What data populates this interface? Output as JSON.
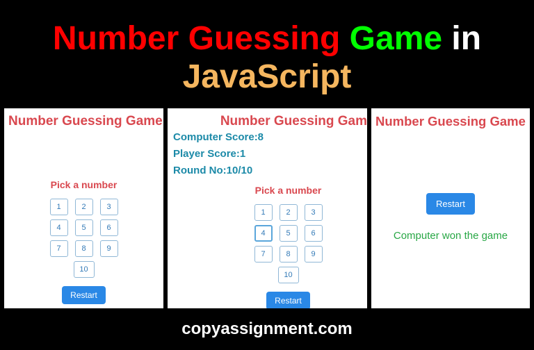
{
  "headline": {
    "parts": [
      {
        "text": "Number Guessing",
        "color": "#ff0000"
      },
      {
        "text": " ",
        "color": "#ffffff"
      },
      {
        "text": "Game",
        "color": "#00ff00"
      },
      {
        "text": " in",
        "color": "#ffffff"
      },
      {
        "text": " JavaScript",
        "color": "#f5b65f"
      }
    ]
  },
  "shots": {
    "title": "Number Guessing Game",
    "title_cut": "Number Guessing Gam",
    "pick_label": "Pick a number",
    "restart_label": "Restart",
    "numbers_row1": [
      "1",
      "2",
      "3"
    ],
    "numbers_row2": [
      "4",
      "5",
      "6"
    ],
    "numbers_row3": [
      "7",
      "8",
      "9"
    ],
    "numbers_row4": [
      "10"
    ],
    "shot2": {
      "stat_computer": "Computer Score:8",
      "stat_player": "Player Score:1",
      "stat_round": "Round No:10/10",
      "highlight": "4"
    },
    "shot3": {
      "won_message": "Computer won the game"
    }
  },
  "footer": "copyassignment.com",
  "chart_data": {
    "type": "table",
    "title": "Number Guessing Game scoreboard (screenshot 2)",
    "rows": [
      {
        "label": "Computer Score",
        "value": 8
      },
      {
        "label": "Player Score",
        "value": 1
      },
      {
        "label": "Round No",
        "value": "10/10"
      }
    ]
  }
}
